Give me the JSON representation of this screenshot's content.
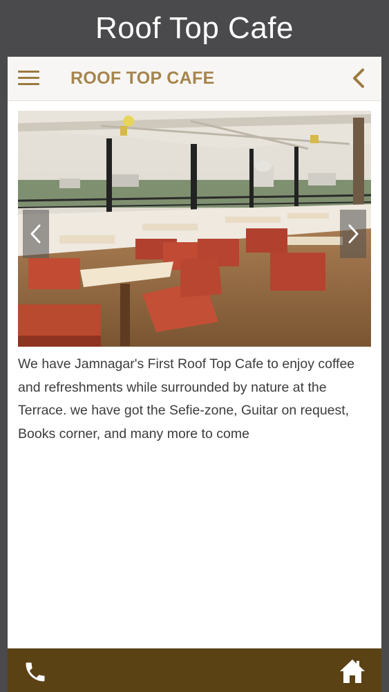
{
  "window": {
    "title": "Roof Top Cafe"
  },
  "navbar": {
    "title": "ROOF TOP CAFE",
    "menu_icon": "hamburger-menu-icon",
    "back_icon": "chevron-left-icon"
  },
  "carousel": {
    "prev_icon": "chevron-left-icon",
    "next_icon": "chevron-right-icon"
  },
  "content": {
    "description": "We have Jamnagar's First Roof Top Cafe to enjoy coffee and refreshments while surrounded by nature at the Terrace. we have got the Sefie-zone, Guitar on request, Books corner, and many more to come"
  },
  "footer": {
    "phone_icon": "phone-icon",
    "home_icon": "home-icon"
  },
  "colors": {
    "chrome_background": "#4a4a4c",
    "navbar_background": "#f7f6f4",
    "brand_gold": "#a5854d",
    "footer_brown": "#5b4215",
    "text": "#3c3c3c"
  }
}
